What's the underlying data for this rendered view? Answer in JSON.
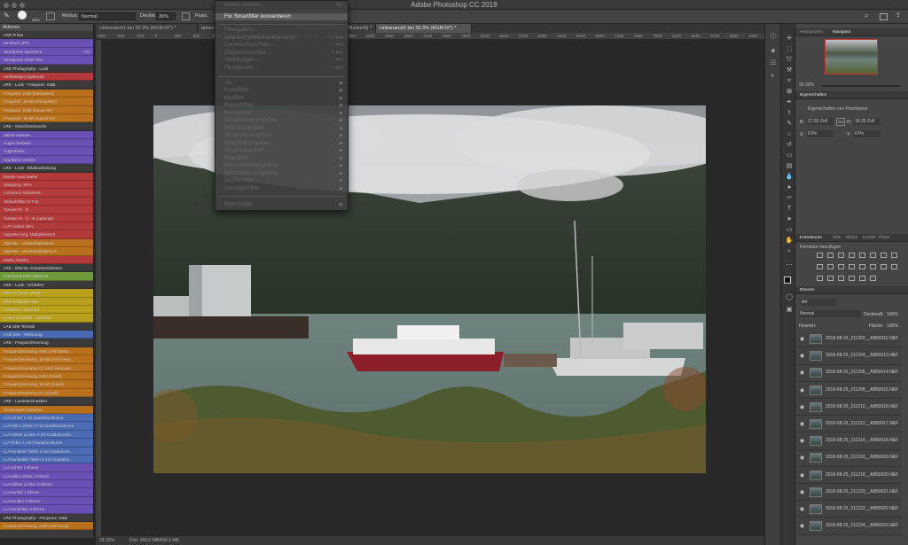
{
  "app_title": "Adobe Photoshop CC 2019",
  "options_bar": {
    "modus_label": "Modus:",
    "modus_value": "Normal",
    "deckkr_label": "Deckkr.:",
    "deckkr_value": "30%",
    "fluss_label": "Fluss:",
    "size_label": "Size"
  },
  "tabs": [
    "Unbenannt1 bei 33.3% (RGB/16*) *",
    "antwerp",
    "Unbenannt1 bei 33.3% (Maske/8) *",
    "Unbenannt2 bei 33.3% (RGB/16*) *"
  ],
  "ruler": [
    "-900",
    "-600",
    "-300",
    "0",
    "300",
    "600",
    "900",
    "1200",
    "1500",
    "1800",
    "2100",
    "2400",
    "2700",
    "3000",
    "3300",
    "3600",
    "3900",
    "4200",
    "4500",
    "4800",
    "5100",
    "5400",
    "5700",
    "6000",
    "6300",
    "6600",
    "6900",
    "7200",
    "7500",
    "7800",
    "8100",
    "8400",
    "8700",
    "9000",
    "9300",
    "9600"
  ],
  "actions_panel": {
    "title": "Aktionen",
    "items": [
      {
        "label": "LRE Privat",
        "color": "#3a3a3a",
        "set": true
      },
      {
        "label": "04-Druck JPG",
        "color": "#6a4fb4"
      },
      {
        "label": "Wordpress speichern",
        "color": "#6a4fb4",
        "shortcut": "⇧F1"
      },
      {
        "label": "Wordpress 2048-70%",
        "color": "#6a4fb4"
      },
      {
        "label": "LRE Photography - Look",
        "color": "#3a3a3a",
        "set": true
      },
      {
        "label": "Verflüssigen (optional)",
        "color": "#b33a3a"
      },
      {
        "label": "LRE - Look - Frequenz. D&B",
        "color": "#3a3a3a",
        "set": true
      },
      {
        "label": "Frequenz. 8-Bit (interpoliert)",
        "color": "#b8701c"
      },
      {
        "label": "Frequenz. 16-Bit (interpoliert)",
        "color": "#b8701c"
      },
      {
        "label": "Frequenz. 8-Bit (Gauss-W.)",
        "color": "#b8701c"
      },
      {
        "label": "Frequenz. 16-Bit (Gauss-W.)",
        "color": "#b8701c"
      },
      {
        "label": "LRE - Gesichtsretusche",
        "color": "#3a3a3a",
        "set": true
      },
      {
        "label": "Zähne weissen",
        "color": "#6a4fb4"
      },
      {
        "label": "Augen betonen",
        "color": "#6a4fb4"
      },
      {
        "label": "Augenfarbe",
        "color": "#6a4fb4"
      },
      {
        "label": "Hautfarbe entrilen",
        "color": "#6a4fb4"
      },
      {
        "label": "LRE - Look - Bildbearbeitung",
        "color": "#3a3a3a",
        "set": true
      },
      {
        "label": "Maske Haut Matter",
        "color": "#b33a3a"
      },
      {
        "label": "Sättigung -30%",
        "color": "#b33a3a"
      },
      {
        "label": "Luminanz Abdunkeln",
        "color": "#b33a3a"
      },
      {
        "label": "Verlaufsfilter S-T-W",
        "color": "#b33a3a"
      },
      {
        "label": "Tonwert R - G",
        "color": "#b33a3a"
      },
      {
        "label": "Tonwert R - G - B (optional)",
        "color": "#b33a3a"
      },
      {
        "label": "LUT Amber 40%",
        "color": "#b33a3a"
      },
      {
        "label": "Vignette (neg. Multiplizieren)",
        "color": "#b33a3a"
      },
      {
        "label": "Vignette - Verlaufsfüllebene",
        "color": "#b8701c"
      },
      {
        "label": "Vignette - Verlaufsfüllebene 6",
        "color": "#b8701c"
      },
      {
        "label": "Matter-Maske",
        "color": "#b33a3a"
      },
      {
        "label": "LRE - Ebenen zusammenfassen",
        "color": "#3a3a3a",
        "set": true
      },
      {
        "label": "Comment-Shift-Option-E",
        "color": "#6f9a3a"
      },
      {
        "label": "LRE - Look - Schärfen",
        "color": "#3a3a3a",
        "set": true
      },
      {
        "label": "HPF Schärfen Weich",
        "color": "#b8a01c"
      },
      {
        "label": "HPF Schärfen Hart",
        "color": "#b8a01c"
      },
      {
        "label": "Schärfen - unscharf",
        "color": "#b8a01c"
      },
      {
        "label": "LAB H schärfen - unscharf",
        "color": "#b8a01c"
      },
      {
        "label": "LAB S/W Technik",
        "color": "#3a3a3a",
        "set": true
      },
      {
        "label": "LAB S/W - Teiltonung",
        "color": "#4a6ab4"
      },
      {
        "label": "LRE - Frequenztrennung",
        "color": "#3a3a3a",
        "set": true
      },
      {
        "label": "Frequenztrennung_8-Bit (Hell interp...",
        "color": "#b8701c"
      },
      {
        "label": "Frequenztrennung_16-Bit (Hell interp...",
        "color": "#b8701c"
      },
      {
        "label": "Frequenztrennung CC (Hell interpolie...",
        "color": "#b8701c"
      },
      {
        "label": "Frequenztrennung_8-Bit (Gauß)",
        "color": "#b8701c"
      },
      {
        "label": "Frequenztrennung_16-Bit (Gauß)",
        "color": "#b8701c"
      },
      {
        "label": "Frequenztrennung CC (Gauß)",
        "color": "#b8701c"
      },
      {
        "label": "LRE - Luminanzmasken",
        "color": "#3a3a3a",
        "set": true
      },
      {
        "label": "Smartobjekt Kopieren",
        "color": "#b8701c"
      },
      {
        "label": "LU-Lichter 1 mit Gradationskurve",
        "color": "#4a6ab4"
      },
      {
        "label": "LU-Helle Lichter 2 mit Gradationskurve",
        "color": "#4a6ab4"
      },
      {
        "label": "LU-Hellste Lichter 3 mit Gradationsku...",
        "color": "#4a6ab4"
      },
      {
        "label": "LU-Tiefen 1 mit Gradationskurve",
        "color": "#4a6ab4"
      },
      {
        "label": "LU-Dunklere Tiefen 2 mit Gradations...",
        "color": "#4a6ab4"
      },
      {
        "label": "LU-Dunkelste Tiefen 3 mit Gradation...",
        "color": "#4a6ab4"
      },
      {
        "label": "LU-Lichter 1 Ebene",
        "color": "#6a4fb4"
      },
      {
        "label": "LU-Helle Lichter 2 Ebene",
        "color": "#6a4fb4"
      },
      {
        "label": "LU-Hellste Lichter 3 Ebene",
        "color": "#6a4fb4"
      },
      {
        "label": "LU-Dunkel 1 Ebene",
        "color": "#6a4fb4"
      },
      {
        "label": "LU-Dunkler 2 Ebene",
        "color": "#6a4fb4"
      },
      {
        "label": "LU-Dunkelste 3 Ebene",
        "color": "#6a4fb4"
      },
      {
        "label": "LRE Photography - Frequenz. D&B",
        "color": "#3a3a3a",
        "set": true
      },
      {
        "label": "Frequenztrennung_8-Bit (Hell interp...",
        "color": "#b8701c"
      }
    ]
  },
  "filter_menu": {
    "items": [
      {
        "label": "Matter machen",
        "shortcut": "⌘F"
      },
      {
        "label": "Für Smartfilter konvertieren",
        "highlighted": true
      },
      {
        "label": "Filtergalerie..."
      },
      {
        "label": "Adaptive Weitwinkelkorrektur...",
        "shortcut": "⌥⇧⌘A"
      },
      {
        "label": "Camera Raw-Filter...",
        "shortcut": "⇧⌘A"
      },
      {
        "label": "Objektivkorrektur...",
        "shortcut": "⇧⌘R"
      },
      {
        "label": "Verflüssigen...",
        "shortcut": "⇧⌘X"
      },
      {
        "label": "Fluchtpunkt...",
        "shortcut": "⌥⌘V"
      },
      {
        "label": "3D",
        "sub": true
      },
      {
        "label": "Kunstfilter",
        "sub": true
      },
      {
        "label": "Malfilter",
        "sub": true
      },
      {
        "label": "Rauschfilter",
        "sub": true
      },
      {
        "label": "Renderfilter",
        "sub": true
      },
      {
        "label": "Scharfzeichnungsfilter",
        "sub": true
      },
      {
        "label": "Stilisierungsfilter",
        "sub": true
      },
      {
        "label": "Strukturierungsfilter",
        "sub": true
      },
      {
        "label": "Vergröberungsfilter",
        "sub": true
      },
      {
        "label": "Verzerrungsfilter",
        "sub": true
      },
      {
        "label": "Videofilter",
        "sub": true
      },
      {
        "label": "Weichzeichnergalerie",
        "sub": true
      },
      {
        "label": "Weichzeichnungsfilter",
        "sub": true
      },
      {
        "label": "Zeichenfilter",
        "sub": true
      },
      {
        "label": "Sonstige Filter",
        "sub": true
      },
      {
        "label": "Neat Image",
        "sub": true
      }
    ]
  },
  "status": {
    "zoom": "33.33%",
    "doc": "Dok: 260,0 MB/690,0 MB"
  },
  "navigator": {
    "tabs": [
      "Histogramm",
      "Navigator"
    ],
    "zoom": "33.33%"
  },
  "properties": {
    "title": "Eigenschaften",
    "subtitle": "Eigenschaften von Pixelebene",
    "b_label": "B:",
    "b_value": "27,52 Zoll",
    "h_label": "H:",
    "h_value": "18,35 Zoll",
    "go": "GO",
    "x_label": "X:",
    "x_value": "0 Px",
    "y_label": "Y:",
    "y_value": "0 Px"
  },
  "adjustments": {
    "tabs": [
      "Korrekturen",
      "Stile",
      "Bibliot",
      "Kanäle",
      "Pfade"
    ],
    "hint": "Korrektur hinzufügen"
  },
  "layers": {
    "title": "Ebenen",
    "filter": "Art",
    "blend": "Normal",
    "opacity_label": "Deckkraft:",
    "opacity": "100%",
    "lock_label": "Fixieren:",
    "fill_label": "Fläche:",
    "fill": "100%",
    "items": [
      "2018-08-25_211202__AB50012.NEF",
      "2018-08-25_211204__AB50013.NEF",
      "2018-08-25_211206__AB50014.NEF",
      "2018-08-25_211208__AB50015.NEF",
      "2018-08-25_211210__AB50016.NEF",
      "2018-08-25_211212__AB50017.NEF",
      "2018-08-25_211214__AB50018.NEF",
      "2018-08-25_211216__AB50019.NEF",
      "2018-08-25_211218__AB50020.NEF",
      "2018-08-25_211220__AB50021.NEF",
      "2018-08-25_211222__AB50022.NEF",
      "2018-08-25_211224__AB50023.NEF"
    ]
  }
}
